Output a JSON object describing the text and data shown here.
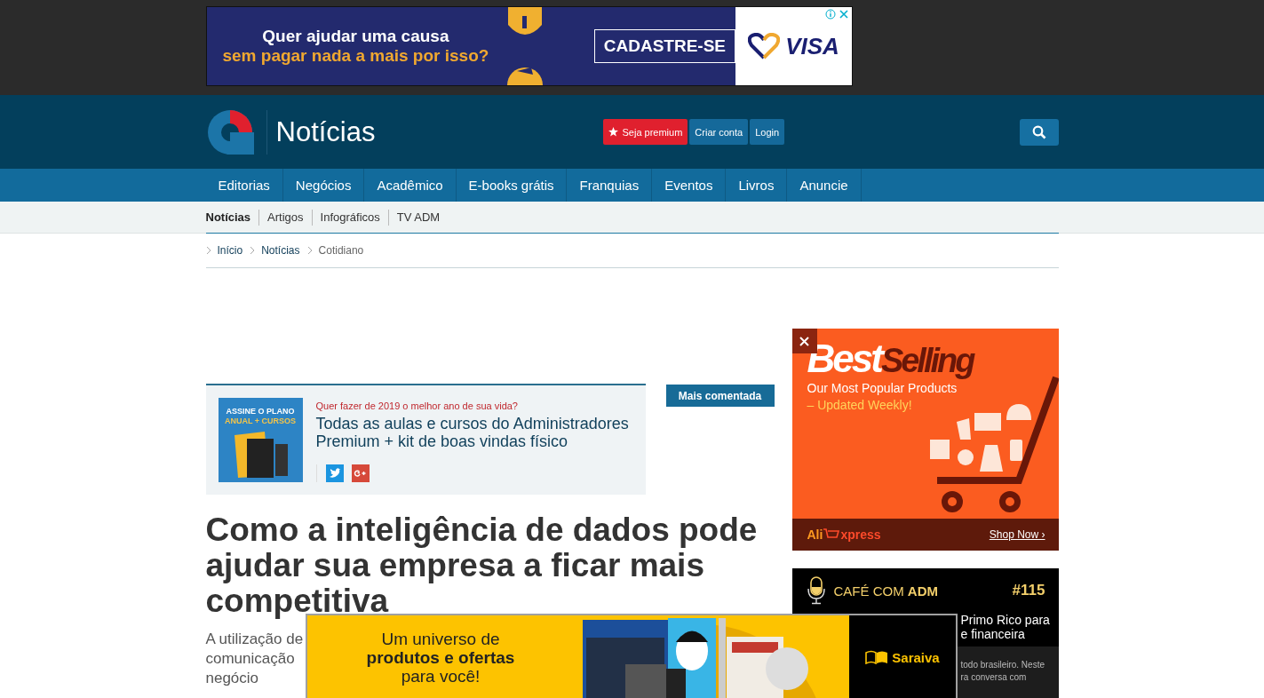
{
  "top_ad": {
    "headline": "Quer ajudar uma causa",
    "subline": "sem pagar nada a mais por isso?",
    "button": "CADASTRE-SE",
    "brand": "VISA"
  },
  "header": {
    "section": "Notícias",
    "premium_button": "Seja premium",
    "signup_button": "Criar conta",
    "login_button": "Login"
  },
  "nav": {
    "items": [
      "Editorias",
      "Negócios",
      "Acadêmico",
      "E-books grátis",
      "Franquias",
      "Eventos",
      "Livros",
      "Anuncie"
    ]
  },
  "subnav": {
    "items": [
      {
        "label": "Notícias",
        "selected": true
      },
      {
        "label": "Artigos",
        "selected": false
      },
      {
        "label": "Infográficos",
        "selected": false
      },
      {
        "label": "TV ADM",
        "selected": false
      }
    ]
  },
  "breadcrumb": [
    "Início",
    "Notícias",
    "Cotidiano"
  ],
  "promo": {
    "cover_lines": [
      "ASSINE O PLANO",
      "ANUAL + CURSOS"
    ],
    "kicker": "Quer fazer de 2019 o melhor ano de sua vida?",
    "title": "Todas as aulas e cursos do Administradores Premium + kit de boas vindas físico"
  },
  "tab": {
    "label": "Mais comentada",
    "selected": true
  },
  "article": {
    "title": "Como a inteligência de dados pode ajudar sua empresa a ficar mais competitiva",
    "lead_lines": [
      "A utilização de",
      "comunicação",
      "negócio"
    ]
  },
  "side_ad": {
    "title_1": "Best",
    "title_2": "Selling",
    "tagline_1": "Our Most Popular Products",
    "tagline_2": "– Updated Weekly!",
    "brand_1": "Ali",
    "brand_2": "xpress",
    "link": "Shop Now ›"
  },
  "podcast": {
    "label": "CAFÉ COM **ADM**",
    "episode": "#115",
    "title_lines": [
      "Primo Rico para",
      "e financeira"
    ],
    "text_lines": [
      "todo brasileiro. Neste",
      "ra conversa com"
    ]
  },
  "bottom_ad": {
    "line_1": "Um universo de",
    "line_2": "produtos e ofertas",
    "line_3": "para você!",
    "brand": "Saraiva"
  }
}
